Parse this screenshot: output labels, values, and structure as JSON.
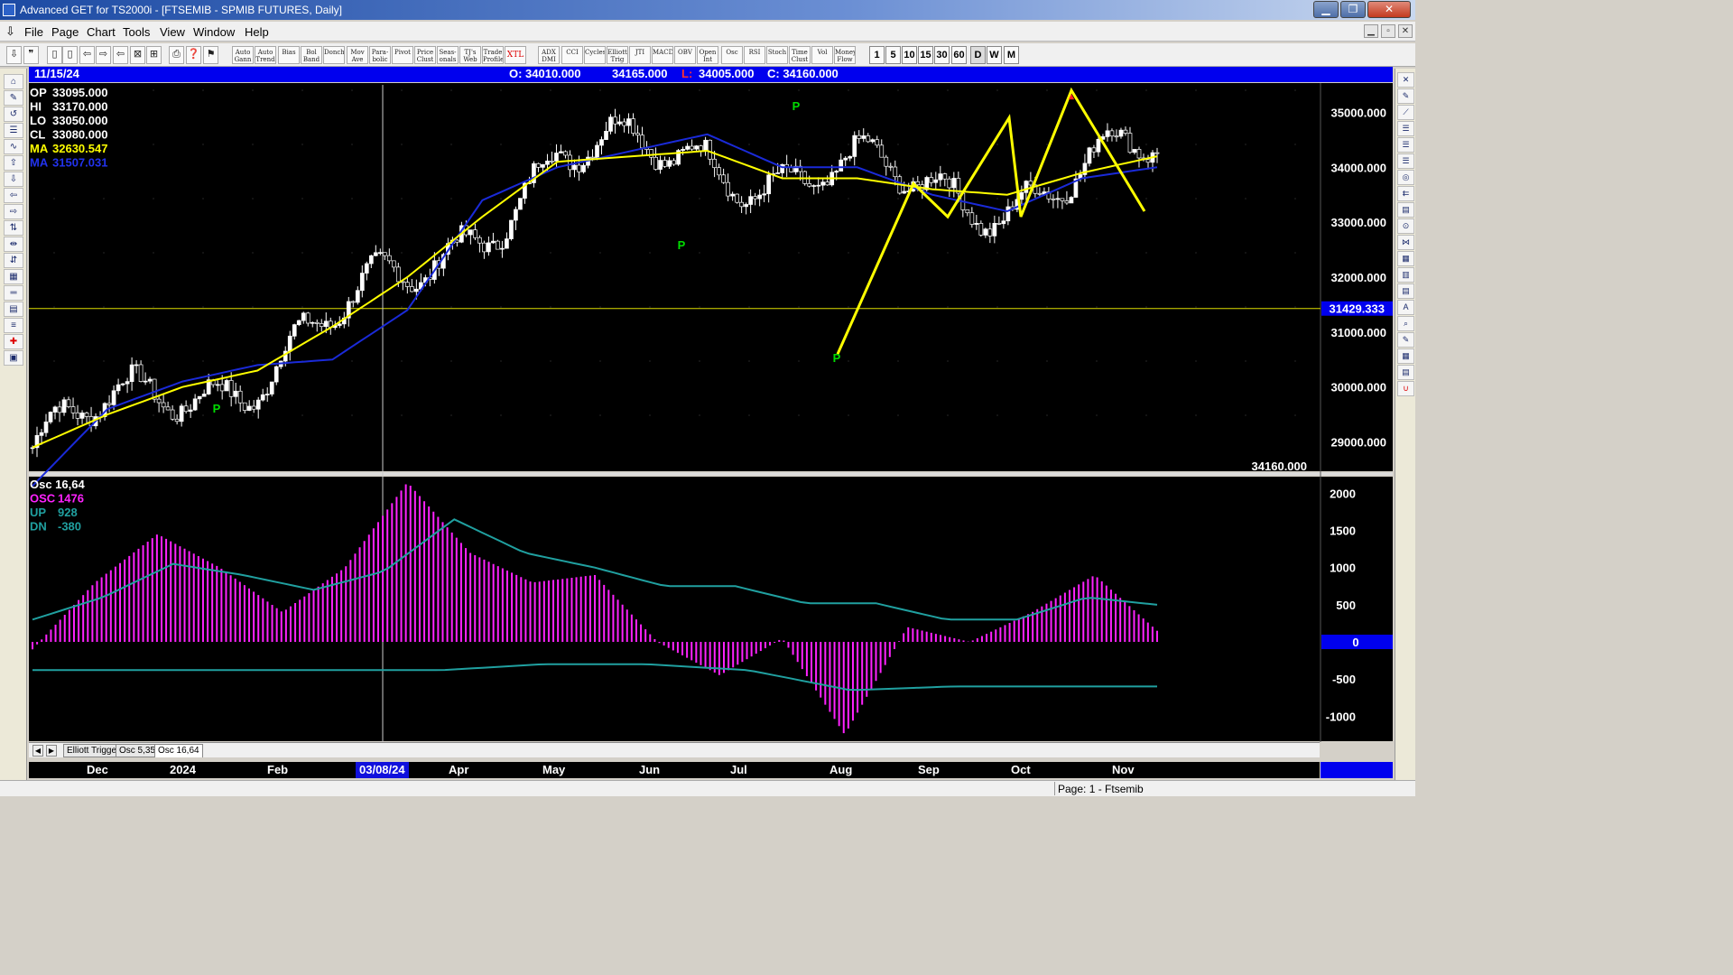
{
  "window": {
    "title": "Advanced GET for TS2000i - [FTSEMIB - SPMIB FUTURES, Daily]",
    "minimize": "▁",
    "maximize": "❐",
    "close": "✕"
  },
  "menu": {
    "items": [
      "File",
      "Page",
      "Chart",
      "Tools",
      "View",
      "Window",
      "Help"
    ],
    "mdi_buttons": [
      "▁",
      "▫",
      "✕"
    ]
  },
  "toolbar": {
    "icon_buttons": [
      "⇩",
      "❞",
      "▯",
      "▯",
      "⇦",
      "⇨",
      "⇦",
      "⊠",
      "⊞",
      "⎙",
      "❓",
      "⚑"
    ],
    "study_buttons": [
      "Auto Gann",
      "Auto Trend",
      "Bias",
      "Bol Band",
      "Donch",
      "Mov Ave",
      "Para-bolic",
      "Pivot",
      "Price Clust",
      "Seas-onals",
      "TJ's Web",
      "Trade Profile",
      "XTL",
      "ADX DMI",
      "CCI",
      "Cycles",
      "Elliott Trig",
      "JTI",
      "MACD",
      "OBV",
      "Open Int",
      "Osc",
      "RSI",
      "Stoch",
      "Time Clust",
      "Vol",
      "Money Flow"
    ],
    "timeframes": [
      "1",
      "5",
      "10",
      "15",
      "30",
      "60",
      "D",
      "W",
      "M"
    ]
  },
  "quote": {
    "date": "11/15/24",
    "open": "O: 34010.000",
    "high": "34165.000",
    "low_label": "L:",
    "low_value": "34005.000",
    "close": "C: 34160.000"
  },
  "price_panel": {
    "readouts": [
      {
        "label": "OP",
        "value": "33095.000",
        "color": "#ffffff"
      },
      {
        "label": "HI",
        "value": "33170.000",
        "color": "#ffffff"
      },
      {
        "label": "LO",
        "value": "33050.000",
        "color": "#ffffff"
      },
      {
        "label": "CL",
        "value": "33080.000",
        "color": "#ffffff"
      },
      {
        "label": "MA",
        "value": "32630.547",
        "color": "#ffff00"
      },
      {
        "label": "MA",
        "value": "31507.031",
        "color": "#2233ee"
      }
    ],
    "y_ticks": [
      "35000.000",
      "34000.000",
      "33000.000",
      "32000.000",
      "31000.000",
      "30000.000",
      "29000.000"
    ],
    "cursor_price": "31429.333",
    "last_price": "34160.000",
    "pivot_label": "P"
  },
  "osc_panel": {
    "readouts": [
      {
        "label": "Osc 16,64",
        "value": "",
        "color": "#ffffff"
      },
      {
        "label": "OSC",
        "value": "1476",
        "color": "#ff22ff"
      },
      {
        "label": "UP",
        "value": "928",
        "color": "#20a0a0"
      },
      {
        "label": "DN",
        "value": "-380",
        "color": "#20a0a0"
      }
    ],
    "y_ticks": [
      "2000",
      "1500",
      "1000",
      "500",
      "-500",
      "-1000"
    ],
    "zero_label": "0"
  },
  "tabs": [
    "Elliott Trigger",
    "Osc 5,35",
    "Osc 16,64"
  ],
  "active_tab": "Osc 16,64",
  "date_axis": {
    "labels": [
      "Dec",
      "2024",
      "Feb",
      "Apr",
      "May",
      "Jun",
      "Jul",
      "Aug",
      "Sep",
      "Oct",
      "Nov"
    ],
    "cursor_date": "03/08/24"
  },
  "status": "Page: 1 - Ftsemib",
  "colors": {
    "background": "#000000",
    "candles": "#ffffff",
    "ma_fast": "#ffff00",
    "ma_slow": "#1a2ad8",
    "elliott": "#ffff00",
    "osc": "#ff22ff",
    "bands": "#20a0a0",
    "pivot": "#00dd00",
    "axis_badge": "#0000ee"
  },
  "chart_data": {
    "type": "candlestick+histogram",
    "symbol": "FTSEMIB - SPMIB FUTURES",
    "period": "Daily",
    "price_ylim": [
      28500,
      35500
    ],
    "osc_ylim": [
      -1300,
      2200
    ],
    "elliott_wave": [
      30600,
      33700,
      33100,
      34900,
      33100,
      35400,
      33200
    ],
    "ma_fast_path": [
      28900,
      29500,
      30000,
      30300,
      31100,
      32000,
      33100,
      34100,
      34200,
      34300,
      33800,
      33800,
      33600,
      33500,
      33900,
      34200
    ],
    "ma_slow_path": [
      28200,
      29600,
      30100,
      30400,
      30500,
      31400,
      33400,
      34000,
      34300,
      34600,
      34000,
      34000,
      33500,
      33200,
      33800,
      34000
    ],
    "osc_histogram_path": [
      -100,
      800,
      1450,
      1000,
      400,
      1000,
      2150,
      1200,
      800,
      900,
      0,
      -450,
      50,
      -1250,
      200,
      0,
      400,
      900,
      150
    ],
    "up_band_path": [
      300,
      600,
      1050,
      900,
      700,
      950,
      1650,
      1200,
      1000,
      750,
      750,
      520,
      520,
      300,
      300,
      600,
      500
    ],
    "dn_band_path": [
      -380,
      -380,
      -380,
      -380,
      -380,
      -300,
      -300,
      -380,
      -650,
      -600,
      -600,
      -600
    ]
  }
}
